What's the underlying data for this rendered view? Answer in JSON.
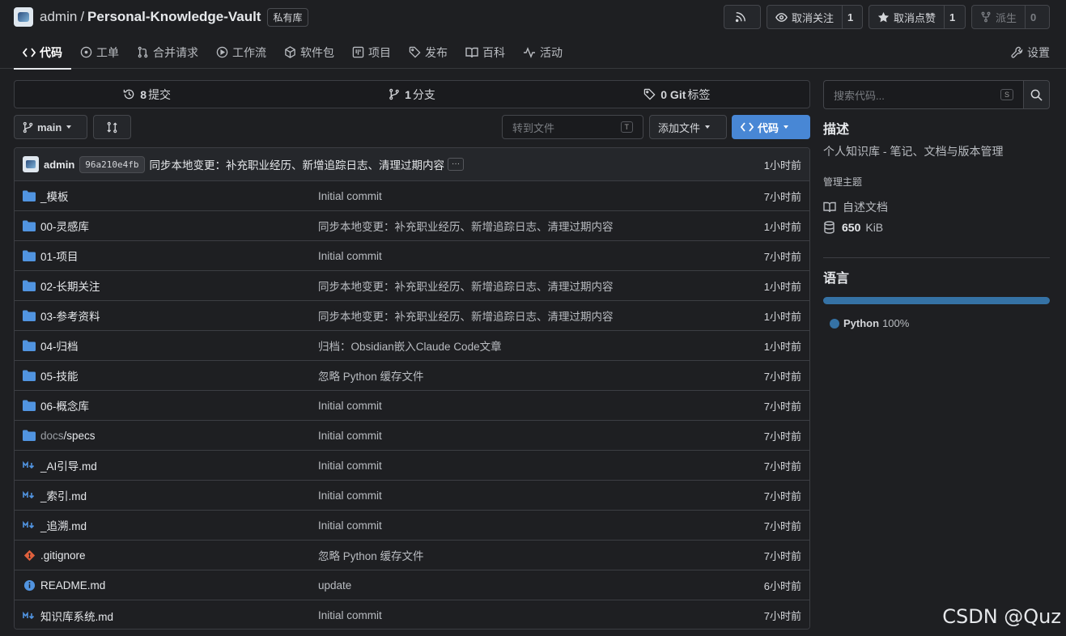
{
  "repo": {
    "owner": "admin",
    "separator": "/",
    "name": "Personal-Knowledge-Vault",
    "visibility": "私有库"
  },
  "actions": {
    "rss_icon": "rss-icon",
    "unwatch_label": "取消关注",
    "unwatch_count": "1",
    "unstar_label": "取消点赞",
    "unstar_count": "1",
    "fork_label": "派生",
    "fork_count": "0"
  },
  "tabs": [
    {
      "label": "代码",
      "icon": "code-icon",
      "active": true
    },
    {
      "label": "工单",
      "icon": "issue-icon"
    },
    {
      "label": "合并请求",
      "icon": "pull-request-icon"
    },
    {
      "label": "工作流",
      "icon": "play-icon"
    },
    {
      "label": "软件包",
      "icon": "package-icon"
    },
    {
      "label": "项目",
      "icon": "project-icon"
    },
    {
      "label": "发布",
      "icon": "tag-icon"
    },
    {
      "label": "百科",
      "icon": "book-icon"
    },
    {
      "label": "活动",
      "icon": "pulse-icon"
    }
  ],
  "settings_label": "设置",
  "stats": {
    "commits_count": "8",
    "commits_label": "提交",
    "branches_count": "1",
    "branches_label": "分支",
    "tags_count": "0 Git",
    "tags_label": "标签"
  },
  "toolbar": {
    "branch": "main",
    "goto_placeholder": "转到文件",
    "goto_key": "T",
    "add_file": "添加文件",
    "code": "代码"
  },
  "latest_commit": {
    "user": "admin",
    "sha": "96a210e4fb",
    "message": "同步本地变更：补充职业经历、新增追踪日志、清理过期内容",
    "ellipsis": "···",
    "time": "1小时前"
  },
  "files": [
    {
      "type": "folder",
      "name": "_模板",
      "prefix": "",
      "message": "Initial commit",
      "time": "7小时前"
    },
    {
      "type": "folder",
      "name": "00-灵感库",
      "prefix": "",
      "message": "同步本地变更：补充职业经历、新增追踪日志、清理过期内容",
      "time": "1小时前"
    },
    {
      "type": "folder",
      "name": "01-项目",
      "prefix": "",
      "message": "Initial commit",
      "time": "7小时前"
    },
    {
      "type": "folder",
      "name": "02-长期关注",
      "prefix": "",
      "message": "同步本地变更：补充职业经历、新增追踪日志、清理过期内容",
      "time": "1小时前"
    },
    {
      "type": "folder",
      "name": "03-参考资料",
      "prefix": "",
      "message": "同步本地变更：补充职业经历、新增追踪日志、清理过期内容",
      "time": "1小时前"
    },
    {
      "type": "folder",
      "name": "04-归档",
      "prefix": "",
      "message": "归档：Obsidian嵌入Claude Code文章",
      "time": "1小时前"
    },
    {
      "type": "folder",
      "name": "05-技能",
      "prefix": "",
      "message": "忽略 Python 缓存文件",
      "time": "7小时前"
    },
    {
      "type": "folder",
      "name": "06-概念库",
      "prefix": "",
      "message": "Initial commit",
      "time": "7小时前"
    },
    {
      "type": "folder",
      "name": "/specs",
      "prefix": "docs",
      "message": "Initial commit",
      "time": "7小时前"
    },
    {
      "type": "markdown",
      "name": "_AI引导.md",
      "prefix": "",
      "message": "Initial commit",
      "time": "7小时前"
    },
    {
      "type": "markdown",
      "name": "_索引.md",
      "prefix": "",
      "message": "Initial commit",
      "time": "7小时前"
    },
    {
      "type": "markdown",
      "name": "_追溯.md",
      "prefix": "",
      "message": "Initial commit",
      "time": "7小时前"
    },
    {
      "type": "git",
      "name": ".gitignore",
      "prefix": "",
      "message": "忽略 Python 缓存文件",
      "time": "7小时前"
    },
    {
      "type": "info",
      "name": "README.md",
      "prefix": "",
      "message": "update",
      "time": "6小时前"
    },
    {
      "type": "markdown",
      "name": "知识库系统.md",
      "prefix": "",
      "message": "Initial commit",
      "time": "7小时前"
    }
  ],
  "sidebar": {
    "search_placeholder": "搜索代码...",
    "search_key": "S",
    "about_title": "描述",
    "description": "个人知识库 - 笔记、文档与版本管理",
    "manage_topics": "管理主题",
    "readme_label": "自述文档",
    "size_value": "650",
    "size_unit": "KiB",
    "languages_title": "语言",
    "language_name": "Python",
    "language_pct": "100%",
    "language_color": "#3572a5"
  },
  "watermark": "CSDN @Quz"
}
